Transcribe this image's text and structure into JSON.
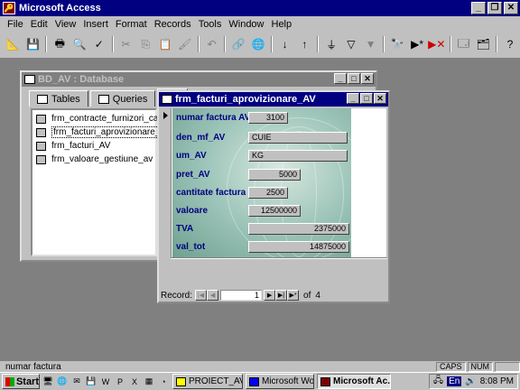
{
  "app": {
    "title": "Microsoft Access"
  },
  "menu": [
    "File",
    "Edit",
    "View",
    "Insert",
    "Format",
    "Records",
    "Tools",
    "Window",
    "Help"
  ],
  "db_window": {
    "title": "BD_AV : Database",
    "tabs": [
      "Tables",
      "Queries"
    ],
    "items": [
      "frm_contracte_furnizori_calarasi",
      "frm_facturi_aprovizionare_AV",
      "frm_facturi_AV",
      "frm_valoare_gestiune_av"
    ]
  },
  "form_window": {
    "title": "frm_facturi_aprovizionare_AV",
    "fields": [
      {
        "label": "numar factura AV",
        "value": "3100"
      },
      {
        "label": "den_mf_AV",
        "value": "CUIE"
      },
      {
        "label": "um_AV",
        "value": "KG"
      },
      {
        "label": "pret_AV",
        "value": "5000"
      },
      {
        "label": "cantitate factura A'",
        "value": "2500"
      },
      {
        "label": "valoare",
        "value": "12500000"
      },
      {
        "label": "TVA",
        "value": "2375000"
      },
      {
        "label": "val_tot",
        "value": "14875000"
      }
    ],
    "nav": {
      "label": "Record:",
      "current": "1",
      "of_label": "of",
      "total": "4"
    }
  },
  "status": {
    "text": "numar factura",
    "caps": "CAPS",
    "num": "NUM"
  },
  "taskbar": {
    "start": "Start",
    "tasks": [
      "PROIECT_AV",
      "Microsoft Word ...",
      "Microsoft Ac..."
    ],
    "lang": "En",
    "clock": "8:08 PM"
  },
  "colors": {
    "title_active": "#000080",
    "desktop": "#808080",
    "field_label": "#000080"
  }
}
